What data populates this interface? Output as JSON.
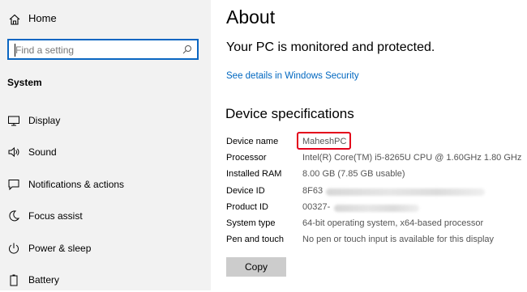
{
  "sidebar": {
    "home_label": "Home",
    "search": {
      "placeholder": "Find a setting"
    },
    "section_title": "System",
    "items": [
      {
        "label": "Display",
        "icon": "monitor-icon"
      },
      {
        "label": "Sound",
        "icon": "speaker-icon"
      },
      {
        "label": "Notifications & actions",
        "icon": "notification-icon"
      },
      {
        "label": "Focus assist",
        "icon": "moon-icon"
      },
      {
        "label": "Power & sleep",
        "icon": "power-icon"
      },
      {
        "label": "Battery",
        "icon": "battery-icon"
      }
    ]
  },
  "main": {
    "title": "About",
    "protection_text": "Your PC is monitored and protected.",
    "security_link": "See details in Windows Security",
    "specs_heading": "Device specifications",
    "specs": [
      {
        "key": "Device name",
        "value": "MaheshPC"
      },
      {
        "key": "Processor",
        "value": "Intel(R) Core(TM) i5-8265U CPU @ 1.60GHz   1.80 GHz"
      },
      {
        "key": "Installed RAM",
        "value": "8.00 GB (7.85 GB usable)"
      },
      {
        "key": "Device ID",
        "value": "8F63"
      },
      {
        "key": "Product ID",
        "value": "00327-"
      },
      {
        "key": "System type",
        "value": "64-bit operating system, x64-based processor"
      },
      {
        "key": "Pen and touch",
        "value": "No pen or touch input is available for this display"
      }
    ],
    "copy_label": "Copy"
  },
  "colors": {
    "accent": "#0a66c2",
    "link": "#0067c0",
    "highlight": "#e3001b"
  }
}
